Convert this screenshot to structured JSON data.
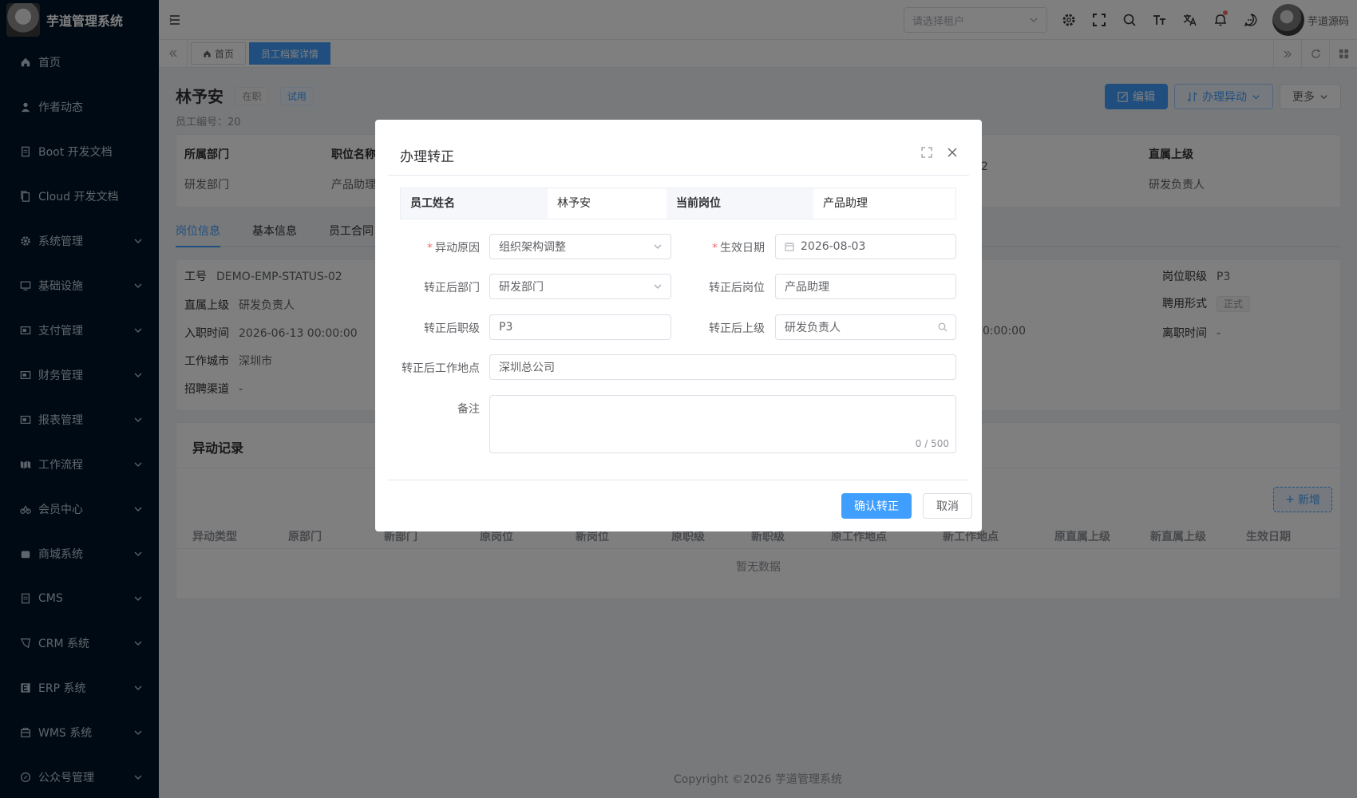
{
  "app": {
    "title": "芋道管理系统"
  },
  "sidebar": {
    "items": [
      {
        "label": "首页",
        "icon": "home-icon"
      },
      {
        "label": "作者动态",
        "icon": "user-icon"
      },
      {
        "label": "Boot 开发文档",
        "icon": "document-icon"
      },
      {
        "label": "Cloud 开发文档",
        "icon": "document-copy-icon"
      },
      {
        "label": "系统管理",
        "icon": "gear-icon"
      },
      {
        "label": "基础设施",
        "icon": "monitor-icon"
      },
      {
        "label": "支付管理",
        "icon": "payment-icon"
      },
      {
        "label": "财务管理",
        "icon": "finance-icon"
      },
      {
        "label": "报表管理",
        "icon": "chart-icon"
      },
      {
        "label": "工作流程",
        "icon": "workflow-icon"
      },
      {
        "label": "会员中心",
        "icon": "member-icon"
      },
      {
        "label": "商城系统",
        "icon": "shop-icon"
      },
      {
        "label": "CMS",
        "icon": "cms-icon"
      },
      {
        "label": "CRM 系统",
        "icon": "crm-icon"
      },
      {
        "label": "ERP 系统",
        "icon": "erp-icon"
      },
      {
        "label": "WMS 系统",
        "icon": "wms-icon"
      },
      {
        "label": "公众号管理",
        "icon": "wechat-icon"
      }
    ]
  },
  "header": {
    "tenant_placeholder": "请选择租户",
    "user_name": "芋道源码"
  },
  "tags": {
    "home": "首页",
    "active": "员工档案详情"
  },
  "profile": {
    "name": "林予安",
    "status": "在职",
    "stage": "试用",
    "employee_no": "员工编号：20",
    "actions": {
      "edit": "编辑",
      "change": "办理异动",
      "more": "更多"
    }
  },
  "info": {
    "dept_label": "所属部门",
    "dept_value": "研发部门",
    "post_label": "职位名称",
    "post_value": "产品助理",
    "hidden_value": "2",
    "leader_label": "直属上级",
    "leader_value": "研发负责人"
  },
  "tabs": [
    "岗位信息",
    "基本信息",
    "员工合同"
  ],
  "detail": {
    "job_no_label": "工号",
    "job_no": "DEMO-EMP-STATUS-02",
    "leader_label": "直属上级",
    "leader": "研发负责人",
    "entry_label": "入职时间",
    "entry": "2026-06-13 00:00:00",
    "city_label": "工作城市",
    "city": "深圳市",
    "channel_label": "招聘渠道",
    "channel": "-",
    "partial_time": "0:00:00",
    "level_label": "岗位职级",
    "level": "P3",
    "hire_label": "聘用形式",
    "hire": "正式",
    "leave_label": "离职时间",
    "leave": "-"
  },
  "records": {
    "title": "异动记录",
    "add": "新增",
    "columns": [
      "异动类型",
      "原部门",
      "新部门",
      "原岗位",
      "新岗位",
      "原职级",
      "新职级",
      "原工作地点",
      "新工作地点",
      "原直属上级",
      "新直属上级",
      "生效日期"
    ],
    "empty": "暂无数据"
  },
  "footer": {
    "copyright": "Copyright ©2026 芋道管理系统"
  },
  "dialog": {
    "title": "办理转正",
    "desc": {
      "name_label": "员工姓名",
      "name": "林予安",
      "post_label": "当前岗位",
      "post": "产品助理"
    },
    "form": {
      "reason_label": "异动原因",
      "reason": "组织架构调整",
      "date_label": "生效日期",
      "date": "2026-08-03",
      "dept_label": "转正后部门",
      "dept": "研发部门",
      "post_label": "转正后岗位",
      "post": "产品助理",
      "level_label": "转正后职级",
      "level": "P3",
      "leader_label": "转正后上级",
      "leader": "研发负责人",
      "location_label": "转正后工作地点",
      "location": "深圳总公司",
      "remark_label": "备注",
      "remark_count": "0 / 500"
    },
    "confirm": "确认转正",
    "cancel": "取消"
  },
  "colors": {
    "primary": "#409eff",
    "sidebar_bg": "#001529",
    "danger": "#f56c6c"
  }
}
